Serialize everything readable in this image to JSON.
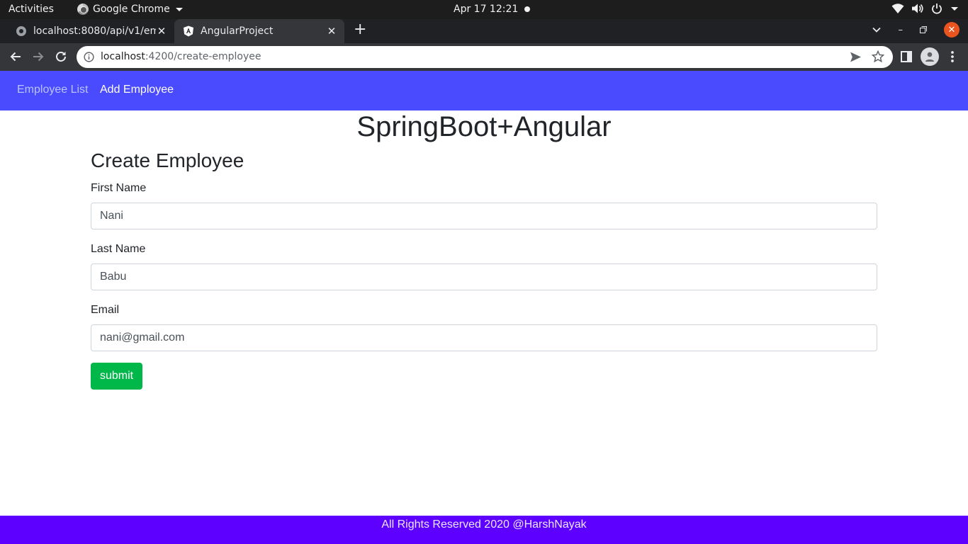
{
  "system_bar": {
    "activities": "Activities",
    "app_name": "Google Chrome",
    "clock": "Apr 17  12:21",
    "icons": [
      "wifi-icon",
      "volume-icon",
      "power-icon",
      "chevron-down-icon"
    ]
  },
  "browser": {
    "tabs": [
      {
        "title": "localhost:8080/api/v1/em",
        "favicon": "globe-icon",
        "active": false
      },
      {
        "title": "AngularProject",
        "favicon": "angular-icon",
        "active": true
      }
    ],
    "url_host": "localhost",
    "url_path": ":4200/create-employee"
  },
  "navbar": {
    "links": [
      "Employee List",
      "Add Employee"
    ],
    "bg_color": "#4a4aff"
  },
  "page": {
    "brand": "SpringBoot+Angular",
    "form_title": "Create Employee",
    "fields": [
      {
        "label": "First Name",
        "value": "Nani"
      },
      {
        "label": "Last Name",
        "value": "Babu"
      },
      {
        "label": "Email",
        "value": "nani@gmail.com"
      }
    ],
    "submit_label": "submit",
    "submit_color": "#00b84a"
  },
  "footer": {
    "text": "All Rights Reserved 2020 @HarshNayak",
    "bg_color": "#5e00ff"
  }
}
